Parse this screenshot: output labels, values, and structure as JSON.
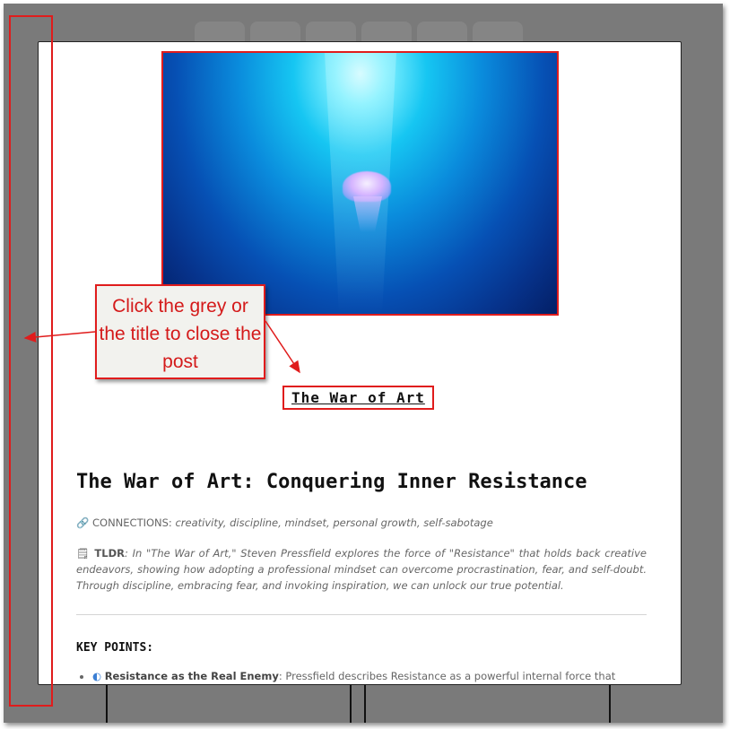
{
  "modal": {
    "hero_image": "jellyfish-underwater-image",
    "title_link": "The War of Art",
    "post_title": "The War of Art: Conquering Inner Resistance",
    "connections_icon": "link-icon",
    "connections_label": "CONNECTIONS:",
    "connections_value": "creativity, discipline, mindset, personal growth, self-sabotage",
    "tldr_icon": "document-icon",
    "tldr_label": "TLDR",
    "tldr_text": "In \"The War of Art,\" Steven Pressfield explores the force of \"Resistance\" that holds back creative endeavors, showing how adopting a professional mindset can overcome procrastination, fear, and self-doubt. Through discipline, embracing fear, and invoking inspiration, we can unlock our true potential.",
    "key_points_heading": "KEY POINTS:",
    "key_points": [
      {
        "icon": "shield-icon",
        "title": "Resistance as the Real Enemy",
        "text": "Pressfield describes Resistance as a powerful internal force that"
      }
    ]
  },
  "annotation": {
    "text": "Click the grey or the title to close the post"
  },
  "colors": {
    "overlay": "#7a7a7a",
    "annotation_red": "#e01c1c",
    "annotation_bg": "#f2f2ee"
  }
}
